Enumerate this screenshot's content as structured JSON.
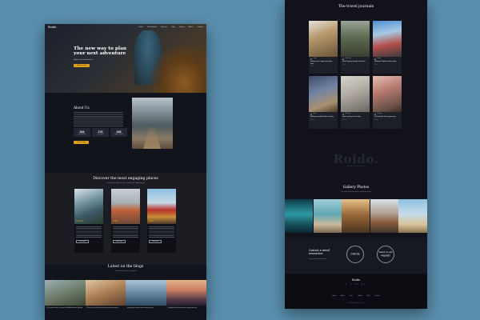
{
  "left_page": {
    "nav": {
      "logo": "Roido",
      "items": [
        "Home",
        "Destinations",
        "Services",
        "Blog",
        "Gallery",
        "About",
        "Contact"
      ]
    },
    "hero": {
      "title": "The new way to plan your next adventure",
      "subtitle": "Explore the world with us",
      "button": "Explore now"
    },
    "about": {
      "title": "About Us",
      "stats": [
        {
          "value": "264",
          "label": "Destinations"
        },
        {
          "value": "176",
          "label": "Tour types"
        },
        {
          "value": "193",
          "label": "Happy clients"
        }
      ],
      "button": "Learn more"
    },
    "places": {
      "title": "Discover the most engaging places",
      "subtitle": "Lorem ipsum dolor sit amet consectetur adipiscing elit",
      "cards": [
        {
          "name": "Norway",
          "button": "Learn more"
        },
        {
          "name": "Chile",
          "button": "Learn more"
        },
        {
          "name": "Japan",
          "button": "Learn more"
        }
      ]
    },
    "blogs": {
      "title": "Latest on the blogs",
      "subtitle": "Get travel tips from our experts",
      "items": [
        {
          "caption": "10 Questions Every Traveler Should Ask Before Booking"
        },
        {
          "caption": "Where to get the best adventure travel experience"
        },
        {
          "caption": "Exploring the world's most stunning cities"
        },
        {
          "caption": "3 things to know before your sunset photo trip"
        }
      ]
    }
  },
  "right_page": {
    "journals": {
      "title": "The travel journals",
      "cards": [
        {
          "meta": "Travel",
          "title": "Exploring the rugged mountain trails",
          "date": "12 Jan",
          "comments": "5"
        },
        {
          "meta": "Adventure",
          "title": "Road tripping through the desert",
          "date": "15 Jan",
          "comments": "3"
        },
        {
          "meta": "Hiking",
          "title": "Hiking the highest alpine peaks",
          "date": "18 Jan",
          "comments": "8"
        },
        {
          "meta": "Work",
          "title": "Working remotely while traveling",
          "date": "20 Jan",
          "comments": "2"
        },
        {
          "meta": "Planning",
          "title": "How to plan your next trip",
          "date": "24 Jan",
          "comments": "6"
        },
        {
          "meta": "Packing",
          "title": "Packing light for long journeys",
          "date": "28 Jan",
          "comments": "4"
        }
      ]
    },
    "watermark": {
      "text": "Roido.",
      "sub": "Explore the world with us"
    },
    "gallery": {
      "title": "Gallery Photos",
      "subtitle": "Our favorite photos from around the world"
    },
    "contact": {
      "title": "Contact a travel researcher",
      "text": "Get personalized trip advice",
      "call_label": "Call Us",
      "call_sub": "+1 234 567 890",
      "send_label": "Send us an enquiry",
      "send_sub": "Contact form"
    },
    "footer": {
      "logo": "Roido",
      "social": "f  t  in  yt",
      "nav": [
        "Home",
        "About",
        "Tours",
        "Gallery",
        "Blog",
        "Contact"
      ],
      "copyright": "© 2023 Roido. All rights reserved."
    }
  },
  "colors": {
    "background": "#5a8fae",
    "page": "#12141c",
    "accent": "#e2a21c"
  }
}
